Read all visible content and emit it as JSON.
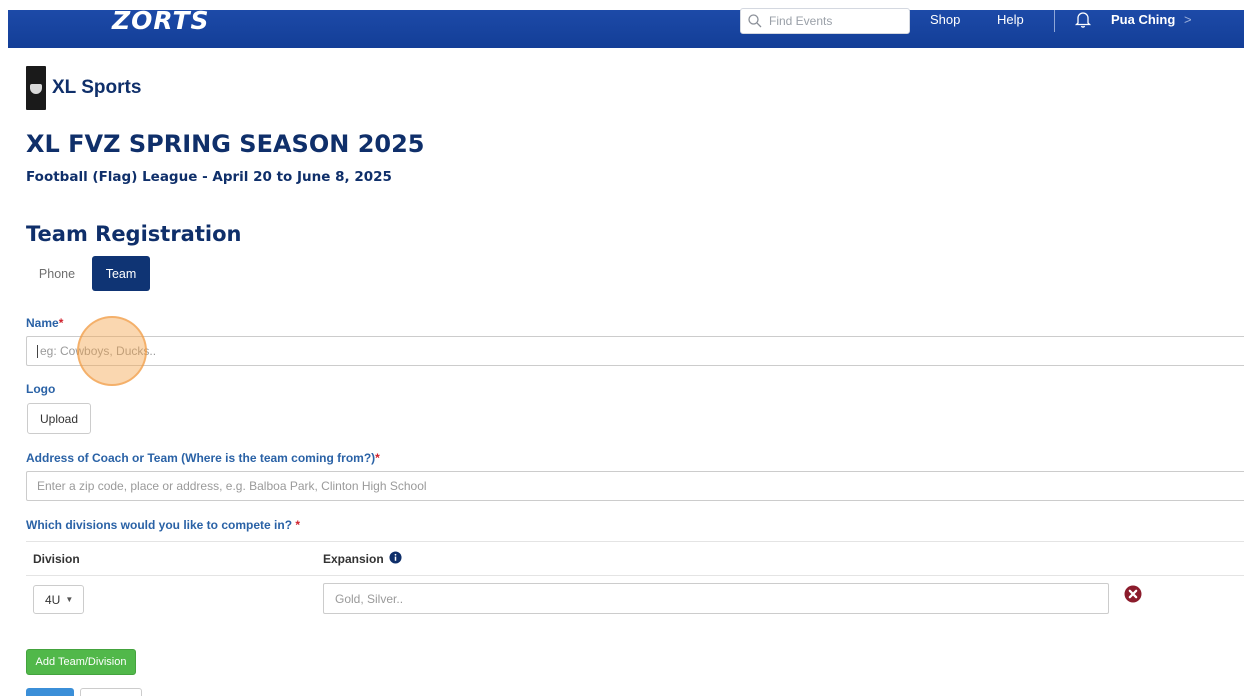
{
  "colors": {
    "brand_blue": "#1d4aa8",
    "navy": "#0f2f6a",
    "label_blue": "#2a62a6",
    "required_red": "#d0212c",
    "add_green": "#51b84a",
    "remove_maroon": "#8b1c2c"
  },
  "header": {
    "logo_text": "ZORTS",
    "search_placeholder": "Find Events",
    "nav": [
      "Shop",
      "Help"
    ],
    "user_name": "Pua Ching",
    "chevron": ">"
  },
  "organization": {
    "name": "XL Sports"
  },
  "event": {
    "title": "XL FVZ SPRING SEASON 2025",
    "subtitle": "Football (Flag) League  -  April 20 to June 8, 2025"
  },
  "registration": {
    "title": "Team Registration",
    "tabs": [
      {
        "label": "Phone",
        "active": false
      },
      {
        "label": "Team",
        "active": true
      }
    ],
    "name_label": "Name",
    "name_placeholder": "eg: Cowboys, Ducks..",
    "logo_label": "Logo",
    "upload_label": "Upload",
    "address_label": "Address of Coach or Team (Where is the team coming from?)",
    "address_placeholder": "Enter a zip code, place or address, e.g. Balboa Park, Clinton High School",
    "divisions_label": "Which divisions would you like to compete in? ",
    "required_mark": "*",
    "table": {
      "headers": [
        "Division",
        "Expansion"
      ],
      "rows": [
        {
          "division": "4U",
          "expansion_placeholder": "Gold, Silver.."
        }
      ]
    },
    "add_button": "Add Team/Division"
  },
  "icons": [
    "search-icon",
    "bell-icon",
    "info-icon",
    "remove-icon",
    "chevron-down-icon"
  ]
}
